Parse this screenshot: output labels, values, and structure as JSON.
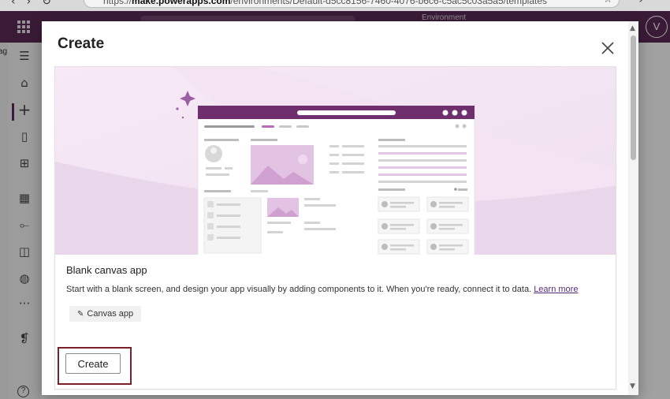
{
  "browser": {
    "url_prefix": "https://",
    "url_host": "make.powerapps.com",
    "url_path": "/environments/Default-d5cc8156-7460-4076-b6c6-c5ac5c03a5a5/templates",
    "back_icon": "back-arrow-icon",
    "forward_icon": "forward-arrow-icon",
    "refresh_icon": "refresh-icon",
    "bookmark_icon": "star-icon"
  },
  "header": {
    "environment_label": "Environment",
    "avatar_initial": "V",
    "brand_color": "#5a2a55"
  },
  "left_edge_text": "ag",
  "nav": {
    "items": [
      {
        "icon": "menu-icon"
      },
      {
        "icon": "home-icon"
      },
      {
        "icon": "create-plus-icon",
        "active": true
      },
      {
        "icon": "learn-book-icon"
      },
      {
        "icon": "apps-icon"
      },
      {
        "icon": "tables-icon"
      },
      {
        "icon": "flows-icon"
      },
      {
        "icon": "solutions-icon"
      },
      {
        "icon": "ai-hub-icon"
      },
      {
        "icon": "more-icon"
      },
      {
        "icon": "power-platform-icon"
      },
      {
        "icon": "help-icon"
      }
    ],
    "help_glyph": "?"
  },
  "modal": {
    "title": "Create",
    "close_icon": "close-icon",
    "card": {
      "title": "Blank canvas app",
      "description": "Start with a blank screen, and design your app visually by adding components to it. When you're ready, connect it to data.",
      "learn_more": "Learn more",
      "tag_label": "Canvas app",
      "tag_icon": "pencil-icon"
    },
    "create_button": "Create",
    "highlight_color": "#7a1f2b"
  }
}
